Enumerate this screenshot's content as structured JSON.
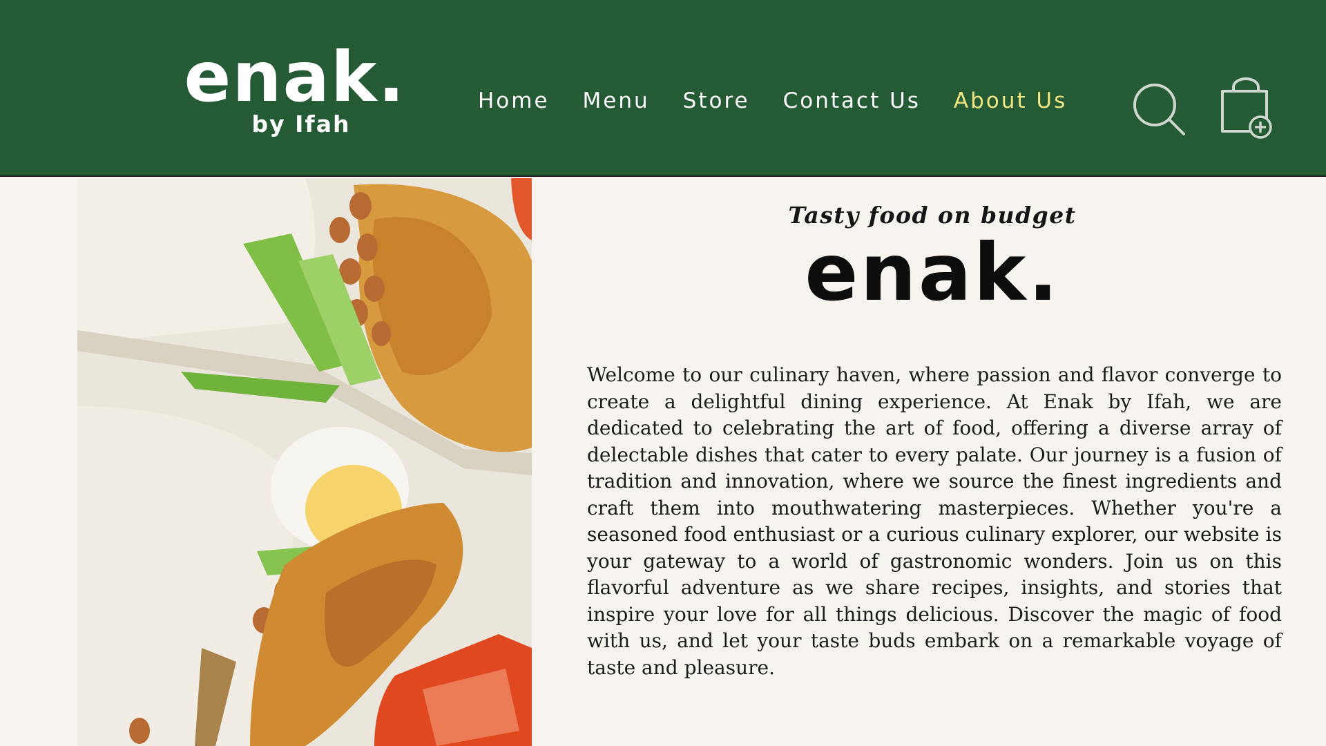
{
  "header": {
    "logo": {
      "word": "enak.",
      "sub": "by Ifah"
    },
    "nav": [
      {
        "label": "Home",
        "active": false
      },
      {
        "label": "Menu",
        "active": false
      },
      {
        "label": "Store",
        "active": false
      },
      {
        "label": "Contact Us",
        "active": false
      },
      {
        "label": "About Us",
        "active": true
      }
    ],
    "icons": {
      "search": "search-icon",
      "cart": "shopping-bag-add-icon"
    }
  },
  "colors": {
    "header_bg": "#245b35",
    "active_nav": "#f1e783",
    "page_bg": "#f7f4ef"
  },
  "main": {
    "image": "nasi-lemak-food-photo",
    "tagline": "Tasty food on budget",
    "title": "enak.",
    "body": "Welcome to our culinary haven, where passion and flavor converge to create a delightful dining experience. At Enak by Ifah, we are dedicated to celebrating the art of food, offering a diverse array of delectable dishes that cater to every palate. Our journey is a fusion of tradition and innovation, where we source the finest ingredients and craft them into mouthwatering masterpieces. Whether you're a seasoned food enthusiast or a curious culinary explorer, our website is your gateway to a world of gastronomic wonders. Join us on this flavorful adventure as we share recipes, insights, and stories that inspire your love for all things delicious. Discover the magic of food with us, and let your taste buds embark on a remarkable voyage of taste and pleasure."
  }
}
